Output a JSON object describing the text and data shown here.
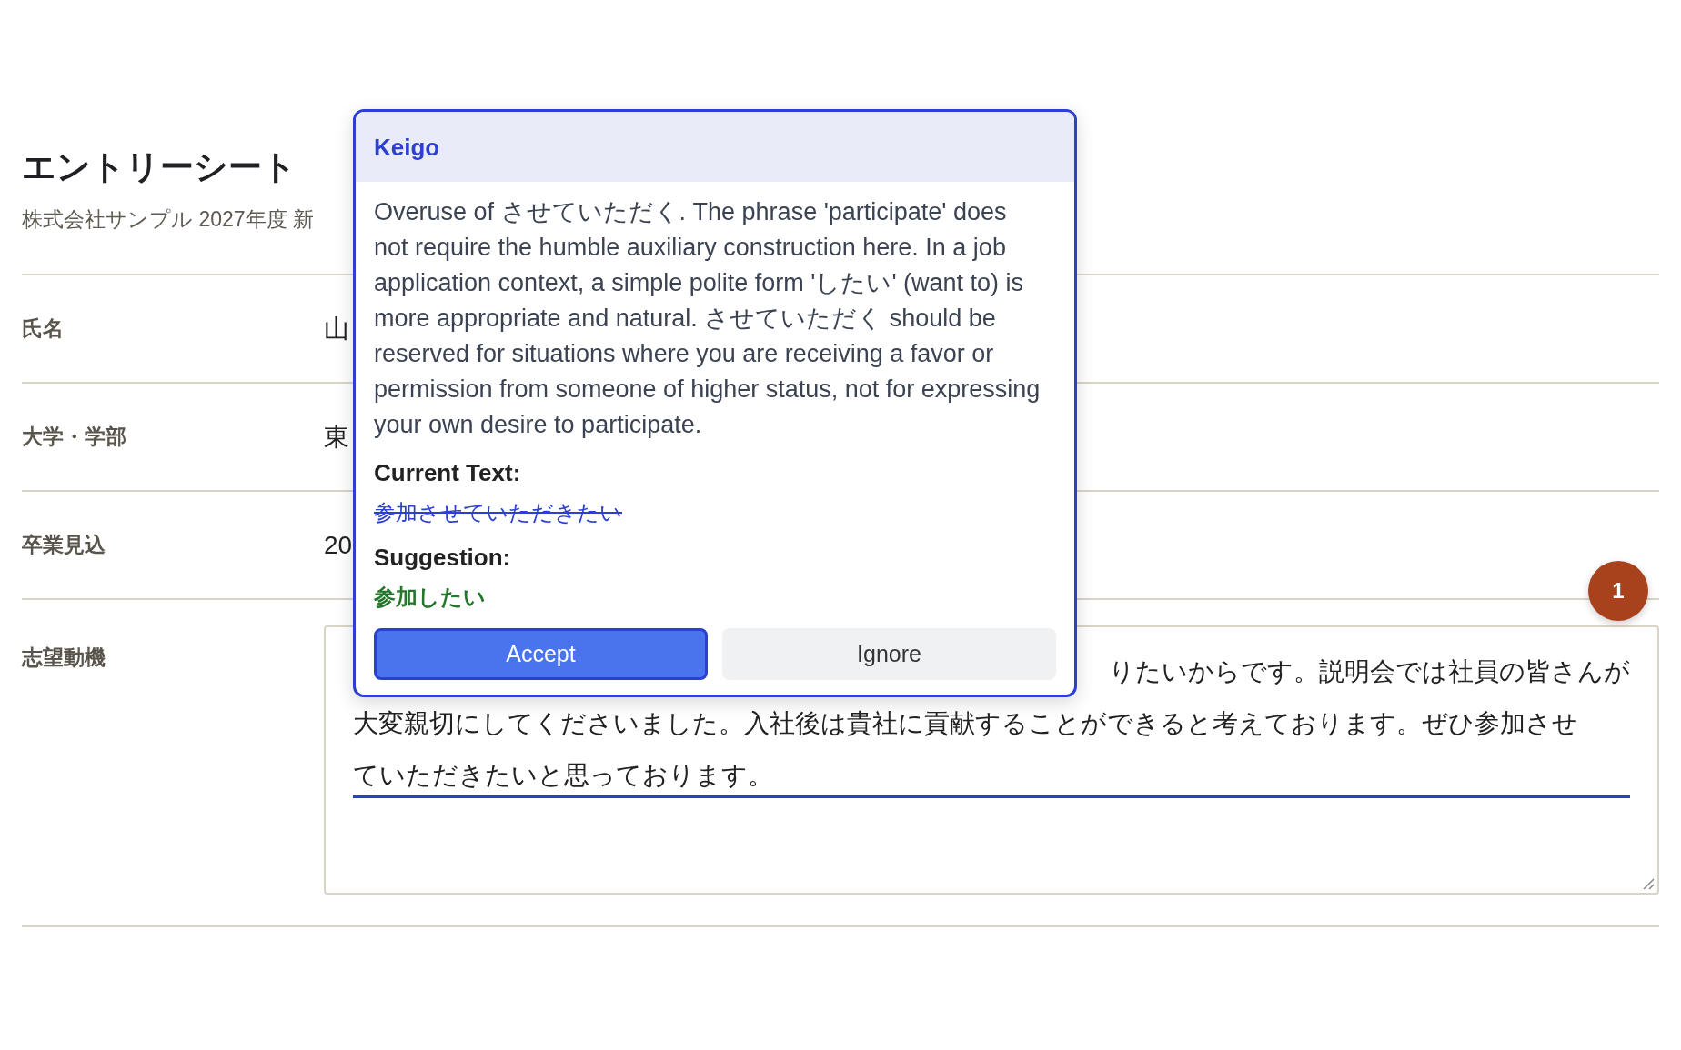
{
  "header": {
    "title": "エントリーシート",
    "subtitle": "株式会社サンプル 2027年度 新"
  },
  "fields": [
    {
      "label": "氏名",
      "kind": "text",
      "value": "山"
    },
    {
      "label": "大学・学部",
      "kind": "text",
      "value": "東"
    },
    {
      "label": "卒業見込",
      "kind": "text",
      "value": "20"
    },
    {
      "label": "志望動機",
      "kind": "textarea",
      "lines": [
        {
          "text": "りたいからです。説明会では社員の皆さんが",
          "covered": true,
          "flagged": false
        },
        {
          "text": "大変親切にしてくださいました。入社後は貴社に貢献することができると考えております。ぜひ参加させ",
          "covered": false,
          "flagged": false
        },
        {
          "text": "ていただきたいと思っております。",
          "covered": false,
          "flagged": true
        }
      ]
    }
  ],
  "popup": {
    "category": "Keigo",
    "explanation": "Overuse of させていただく. The phrase 'participate' does not require the humble auxiliary construction here. In a job application context, a simple polite form 'したい' (want to) is more appropriate and natural. させていただく should be reserved for situations where you are receiving a favor or permission from someone of higher status, not for expressing your own desire to participate.",
    "current_label": "Current Text:",
    "current_text": "参加させていただきたい",
    "suggestion_label": "Suggestion:",
    "suggestion_text": "参加したい",
    "buttons": [
      {
        "label": "Accept",
        "kind": "primary"
      },
      {
        "label": "Ignore",
        "kind": "secondary"
      }
    ]
  },
  "issue_badge": {
    "count": "1"
  }
}
